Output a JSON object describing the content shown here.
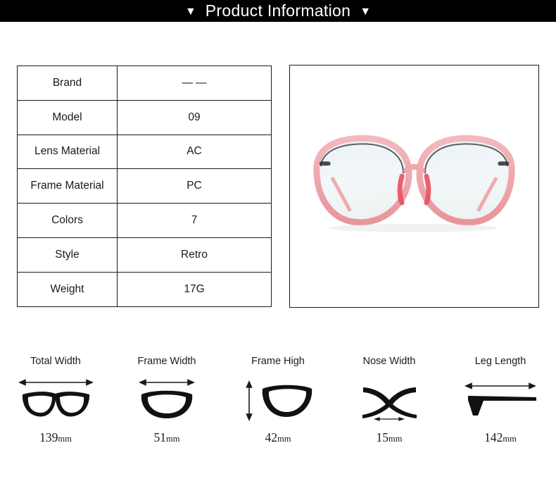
{
  "header": {
    "left_triangle": "▼",
    "title": "Product Information",
    "right_triangle": "▼",
    "background_color": "#000000",
    "text_color": "#ffffff"
  },
  "spec_table": {
    "rows": [
      {
        "label": "Brand",
        "value": "— —"
      },
      {
        "label": "Model",
        "value": "09"
      },
      {
        "label": "Lens Material",
        "value": "AC"
      },
      {
        "label": "Frame Material",
        "value": "PC"
      },
      {
        "label": "Colors",
        "value": "7"
      },
      {
        "label": "Style",
        "value": "Retro"
      },
      {
        "label": "Weight",
        "value": "17G"
      }
    ]
  },
  "product_photo": {
    "alt": "Pink translucent round eyeglasses front view",
    "frame_color": "#f0a7ac",
    "accent_color": "#e8505b",
    "lens_color": "#eef4f6"
  },
  "measurements": [
    {
      "label": "Total Width",
      "number": "139",
      "unit": "mm",
      "icon": "full-glasses-width-icon"
    },
    {
      "label": "Frame Width",
      "number": "51",
      "unit": "mm",
      "icon": "single-lens-width-icon"
    },
    {
      "label": "Frame High",
      "number": "42",
      "unit": "mm",
      "icon": "single-lens-height-icon"
    },
    {
      "label": "Nose Width",
      "number": "15",
      "unit": "mm",
      "icon": "nose-bridge-icon"
    },
    {
      "label": "Leg Length",
      "number": "142",
      "unit": "mm",
      "icon": "temple-arm-icon"
    }
  ]
}
